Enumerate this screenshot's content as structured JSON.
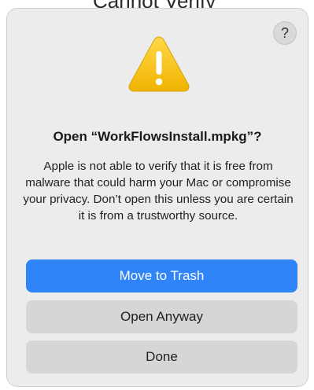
{
  "background": {
    "partial_text": "Cannot Verify"
  },
  "dialog": {
    "help_label": "?",
    "warning_icon": "warning-triangle-exclamation",
    "title": "Open “WorkFlowsInstall.mpkg”?",
    "message": "Apple is not able to verify that it is free from malware that could harm your Mac or compromise your privacy. Don’t open this unless you are certain it is from a trustworthy source.",
    "buttons": {
      "move_to_trash": "Move to Trash",
      "open_anyway": "Open Anyway",
      "done": "Done"
    }
  },
  "colors": {
    "primary_button": "#2f84f7",
    "secondary_button": "#d6d6d6",
    "warning_yellow": "#f5c325"
  }
}
